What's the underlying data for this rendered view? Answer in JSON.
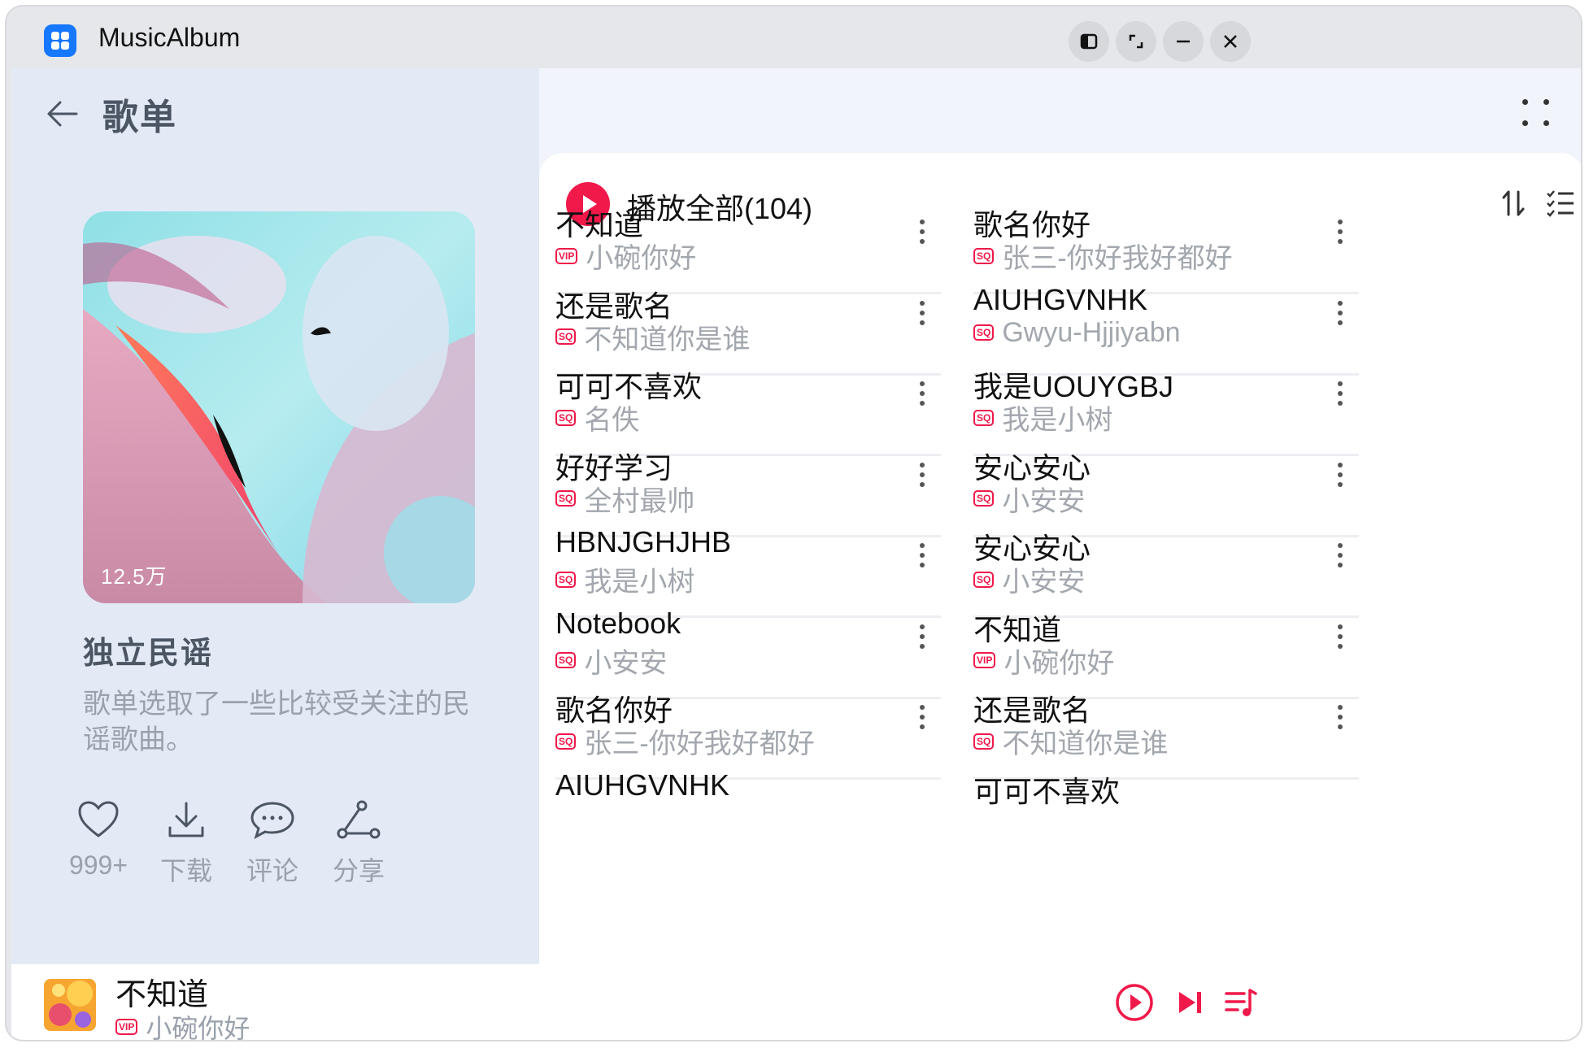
{
  "window": {
    "app_title": "MusicAlbum"
  },
  "left_panel": {
    "title": "歌单",
    "play_count": "12.5万",
    "album_name": "独立民谣",
    "album_desc": "歌单选取了一些比较受关注的民谣歌曲。",
    "actions": [
      {
        "label": "999+",
        "icon": "heart-icon"
      },
      {
        "label": "下载",
        "icon": "download-icon"
      },
      {
        "label": "评论",
        "icon": "comment-icon"
      },
      {
        "label": "分享",
        "icon": "share-icon"
      }
    ]
  },
  "list": {
    "play_all": "播放全部(104)",
    "songs": [
      {
        "title": "不知道",
        "badge": "VIP",
        "artist": "小碗你好"
      },
      {
        "title": "歌名你好",
        "badge": "SQ",
        "artist": "张三-你好我好都好"
      },
      {
        "title": "还是歌名",
        "badge": "SQ",
        "artist": "不知道你是谁"
      },
      {
        "title": "AIUHGVNHK",
        "badge": "SQ",
        "artist": "Gwyu-Hjjiyabn"
      },
      {
        "title": "可可不喜欢",
        "badge": "SQ",
        "artist": "名佚"
      },
      {
        "title": "我是UOUYGBJ",
        "badge": "SQ",
        "artist": "我是小树"
      },
      {
        "title": "好好学习",
        "badge": "SQ",
        "artist": "全村最帅"
      },
      {
        "title": "安心安心",
        "badge": "SQ",
        "artist": "小安安"
      },
      {
        "title": "HBNJGHJHB",
        "badge": "SQ",
        "artist": "我是小树"
      },
      {
        "title": "安心安心",
        "badge": "SQ",
        "artist": "小安安"
      },
      {
        "title": "Notebook",
        "badge": "SQ",
        "artist": "小安安"
      },
      {
        "title": "不知道",
        "badge": "VIP",
        "artist": "小碗你好"
      },
      {
        "title": "歌名你好",
        "badge": "SQ",
        "artist": "张三-你好我好都好"
      },
      {
        "title": "还是歌名",
        "badge": "SQ",
        "artist": "不知道你是谁"
      },
      {
        "title": "AIUHGVNHK",
        "badge": "",
        "artist": ""
      },
      {
        "title": "可可不喜欢",
        "badge": "",
        "artist": ""
      }
    ]
  },
  "player": {
    "title": "不知道",
    "badge": "VIP",
    "artist": "小碗你好"
  },
  "colors": {
    "accent": "#f0194a",
    "app_icon": "#1677ff",
    "left_bg": "#e3eaf6"
  }
}
